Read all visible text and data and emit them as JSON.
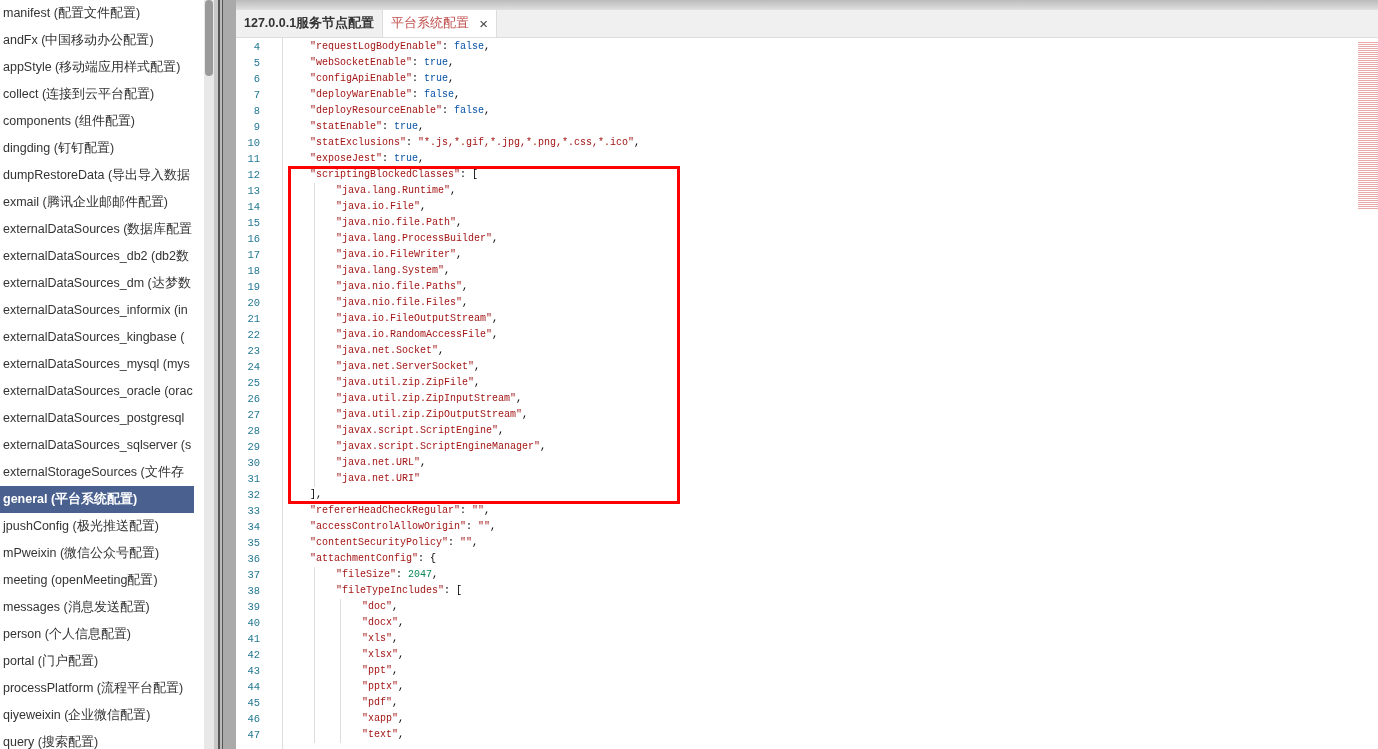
{
  "sidebar": {
    "items": [
      {
        "label": "manifest (配置文件配置)",
        "selected": false
      },
      {
        "label": "andFx (中国移动办公配置)",
        "selected": false
      },
      {
        "label": "appStyle (移动端应用样式配置)",
        "selected": false
      },
      {
        "label": "collect (连接到云平台配置)",
        "selected": false
      },
      {
        "label": "components (组件配置)",
        "selected": false
      },
      {
        "label": "dingding (钉钉配置)",
        "selected": false
      },
      {
        "label": "dumpRestoreData (导出导入数据",
        "selected": false
      },
      {
        "label": "exmail (腾讯企业邮邮件配置)",
        "selected": false
      },
      {
        "label": "externalDataSources (数据库配置",
        "selected": false
      },
      {
        "label": "externalDataSources_db2 (db2数",
        "selected": false
      },
      {
        "label": "externalDataSources_dm (达梦数",
        "selected": false
      },
      {
        "label": "externalDataSources_informix (in",
        "selected": false
      },
      {
        "label": "externalDataSources_kingbase (",
        "selected": false
      },
      {
        "label": "externalDataSources_mysql (mys",
        "selected": false
      },
      {
        "label": "externalDataSources_oracle (orac",
        "selected": false
      },
      {
        "label": "externalDataSources_postgresql",
        "selected": false
      },
      {
        "label": "externalDataSources_sqlserver (s",
        "selected": false
      },
      {
        "label": "externalStorageSources (文件存",
        "selected": false
      },
      {
        "label": "general (平台系统配置)",
        "selected": true
      },
      {
        "label": "jpushConfig (极光推送配置)",
        "selected": false
      },
      {
        "label": "mPweixin (微信公众号配置)",
        "selected": false
      },
      {
        "label": "meeting (openMeeting配置)",
        "selected": false
      },
      {
        "label": "messages (消息发送配置)",
        "selected": false
      },
      {
        "label": "person (个人信息配置)",
        "selected": false
      },
      {
        "label": "portal (门户配置)",
        "selected": false
      },
      {
        "label": "processPlatform (流程平台配置)",
        "selected": false
      },
      {
        "label": "qiyeweixin (企业微信配置)",
        "selected": false
      },
      {
        "label": "query (搜索配置)",
        "selected": false
      }
    ]
  },
  "tabs": [
    {
      "label": "127.0.0.1服务节点配置",
      "selected": false
    },
    {
      "label": "平台系统配置",
      "selected": true,
      "close_glyph": "×"
    }
  ],
  "code": {
    "lines": [
      {
        "no": "4",
        "tokens": [
          {
            "kind": "key",
            "text": "\"requestLogBodyEnable\""
          },
          {
            "kind": "punct",
            "text": ": "
          },
          {
            "kind": "bool",
            "text": "false"
          },
          {
            "kind": "punct",
            "text": ","
          }
        ]
      },
      {
        "no": "5",
        "tokens": [
          {
            "kind": "key",
            "text": "\"webSocketEnable\""
          },
          {
            "kind": "punct",
            "text": ": "
          },
          {
            "kind": "bool",
            "text": "true"
          },
          {
            "kind": "punct",
            "text": ","
          }
        ]
      },
      {
        "no": "6",
        "tokens": [
          {
            "kind": "key",
            "text": "\"configApiEnable\""
          },
          {
            "kind": "punct",
            "text": ": "
          },
          {
            "kind": "bool",
            "text": "true"
          },
          {
            "kind": "punct",
            "text": ","
          }
        ]
      },
      {
        "no": "7",
        "tokens": [
          {
            "kind": "key",
            "text": "\"deployWarEnable\""
          },
          {
            "kind": "punct",
            "text": ": "
          },
          {
            "kind": "bool",
            "text": "false"
          },
          {
            "kind": "punct",
            "text": ","
          }
        ]
      },
      {
        "no": "8",
        "tokens": [
          {
            "kind": "key",
            "text": "\"deployResourceEnable\""
          },
          {
            "kind": "punct",
            "text": ": "
          },
          {
            "kind": "bool",
            "text": "false"
          },
          {
            "kind": "punct",
            "text": ","
          }
        ]
      },
      {
        "no": "9",
        "tokens": [
          {
            "kind": "key",
            "text": "\"statEnable\""
          },
          {
            "kind": "punct",
            "text": ": "
          },
          {
            "kind": "bool",
            "text": "true"
          },
          {
            "kind": "punct",
            "text": ","
          }
        ]
      },
      {
        "no": "10",
        "tokens": [
          {
            "kind": "key",
            "text": "\"statExclusions\""
          },
          {
            "kind": "punct",
            "text": ": "
          },
          {
            "kind": "string",
            "text": "\"*.js,*.gif,*.jpg,*.png,*.css,*.ico\""
          },
          {
            "kind": "punct",
            "text": ","
          }
        ]
      },
      {
        "no": "11",
        "tokens": [
          {
            "kind": "key",
            "text": "\"exposeJest\""
          },
          {
            "kind": "punct",
            "text": ": "
          },
          {
            "kind": "bool",
            "text": "true"
          },
          {
            "kind": "punct",
            "text": ","
          }
        ]
      },
      {
        "no": "12",
        "highlighted": true,
        "tokens": [
          {
            "kind": "key",
            "text": "\"scriptingBlockedClasses\""
          },
          {
            "kind": "punct",
            "text": ": ["
          }
        ],
        "children": [
          {
            "no": "13",
            "tokens": [
              {
                "kind": "string",
                "text": "\"java.lang.Runtime\""
              },
              {
                "kind": "punct",
                "text": ","
              }
            ]
          },
          {
            "no": "14",
            "tokens": [
              {
                "kind": "string",
                "text": "\"java.io.File\""
              },
              {
                "kind": "punct",
                "text": ","
              }
            ]
          },
          {
            "no": "15",
            "tokens": [
              {
                "kind": "string",
                "text": "\"java.nio.file.Path\""
              },
              {
                "kind": "punct",
                "text": ","
              }
            ]
          },
          {
            "no": "16",
            "tokens": [
              {
                "kind": "string",
                "text": "\"java.lang.ProcessBuilder\""
              },
              {
                "kind": "punct",
                "text": ","
              }
            ]
          },
          {
            "no": "17",
            "tokens": [
              {
                "kind": "string",
                "text": "\"java.io.FileWriter\""
              },
              {
                "kind": "punct",
                "text": ","
              }
            ]
          },
          {
            "no": "18",
            "tokens": [
              {
                "kind": "string",
                "text": "\"java.lang.System\""
              },
              {
                "kind": "punct",
                "text": ","
              }
            ]
          },
          {
            "no": "19",
            "tokens": [
              {
                "kind": "string",
                "text": "\"java.nio.file.Paths\""
              },
              {
                "kind": "punct",
                "text": ","
              }
            ]
          },
          {
            "no": "20",
            "tokens": [
              {
                "kind": "string",
                "text": "\"java.nio.file.Files\""
              },
              {
                "kind": "punct",
                "text": ","
              }
            ]
          },
          {
            "no": "21",
            "tokens": [
              {
                "kind": "string",
                "text": "\"java.io.FileOutputStream\""
              },
              {
                "kind": "punct",
                "text": ","
              }
            ]
          },
          {
            "no": "22",
            "tokens": [
              {
                "kind": "string",
                "text": "\"java.io.RandomAccessFile\""
              },
              {
                "kind": "punct",
                "text": ","
              }
            ]
          },
          {
            "no": "23",
            "tokens": [
              {
                "kind": "string",
                "text": "\"java.net.Socket\""
              },
              {
                "kind": "punct",
                "text": ","
              }
            ]
          },
          {
            "no": "24",
            "tokens": [
              {
                "kind": "string",
                "text": "\"java.net.ServerSocket\""
              },
              {
                "kind": "punct",
                "text": ","
              }
            ]
          },
          {
            "no": "25",
            "tokens": [
              {
                "kind": "string",
                "text": "\"java.util.zip.ZipFile\""
              },
              {
                "kind": "punct",
                "text": ","
              }
            ]
          },
          {
            "no": "26",
            "tokens": [
              {
                "kind": "string",
                "text": "\"java.util.zip.ZipInputStream\""
              },
              {
                "kind": "punct",
                "text": ","
              }
            ]
          },
          {
            "no": "27",
            "tokens": [
              {
                "kind": "string",
                "text": "\"java.util.zip.ZipOutputStream\""
              },
              {
                "kind": "punct",
                "text": ","
              }
            ]
          },
          {
            "no": "28",
            "tokens": [
              {
                "kind": "string",
                "text": "\"javax.script.ScriptEngine\""
              },
              {
                "kind": "punct",
                "text": ","
              }
            ]
          },
          {
            "no": "29",
            "tokens": [
              {
                "kind": "string",
                "text": "\"javax.script.ScriptEngineManager\""
              },
              {
                "kind": "punct",
                "text": ","
              }
            ]
          },
          {
            "no": "30",
            "tokens": [
              {
                "kind": "string",
                "text": "\"java.net.URL\""
              },
              {
                "kind": "punct",
                "text": ","
              }
            ]
          },
          {
            "no": "31",
            "tokens": [
              {
                "kind": "string",
                "text": "\"java.net.URI\""
              }
            ]
          }
        ],
        "close": {
          "no": "32",
          "tokens": [
            {
              "kind": "punct",
              "text": "],"
            }
          ]
        }
      },
      {
        "no": "33",
        "tokens": [
          {
            "kind": "key",
            "text": "\"refererHeadCheckRegular\""
          },
          {
            "kind": "punct",
            "text": ": "
          },
          {
            "kind": "string",
            "text": "\"\""
          },
          {
            "kind": "punct",
            "text": ","
          }
        ]
      },
      {
        "no": "34",
        "tokens": [
          {
            "kind": "key",
            "text": "\"accessControlAllowOrigin\""
          },
          {
            "kind": "punct",
            "text": ": "
          },
          {
            "kind": "string",
            "text": "\"\""
          },
          {
            "kind": "punct",
            "text": ","
          }
        ]
      },
      {
        "no": "35",
        "tokens": [
          {
            "kind": "key",
            "text": "\"contentSecurityPolicy\""
          },
          {
            "kind": "punct",
            "text": ": "
          },
          {
            "kind": "string",
            "text": "\"\""
          },
          {
            "kind": "punct",
            "text": ","
          }
        ]
      },
      {
        "no": "36",
        "tokens": [
          {
            "kind": "key",
            "text": "\"attachmentConfig\""
          },
          {
            "kind": "punct",
            "text": ": {"
          }
        ],
        "children": [
          {
            "no": "37",
            "tokens": [
              {
                "kind": "key",
                "text": "\"fileSize\""
              },
              {
                "kind": "punct",
                "text": ": "
              },
              {
                "kind": "number",
                "text": "2047"
              },
              {
                "kind": "punct",
                "text": ","
              }
            ]
          },
          {
            "no": "38",
            "tokens": [
              {
                "kind": "key",
                "text": "\"fileTypeIncludes\""
              },
              {
                "kind": "punct",
                "text": ": ["
              }
            ],
            "children": [
              {
                "no": "39",
                "tokens": [
                  {
                    "kind": "string",
                    "text": "\"doc\""
                  },
                  {
                    "kind": "punct",
                    "text": ","
                  }
                ]
              },
              {
                "no": "40",
                "tokens": [
                  {
                    "kind": "string",
                    "text": "\"docx\""
                  },
                  {
                    "kind": "punct",
                    "text": ","
                  }
                ]
              },
              {
                "no": "41",
                "tokens": [
                  {
                    "kind": "string",
                    "text": "\"xls\""
                  },
                  {
                    "kind": "punct",
                    "text": ","
                  }
                ]
              },
              {
                "no": "42",
                "tokens": [
                  {
                    "kind": "string",
                    "text": "\"xlsx\""
                  },
                  {
                    "kind": "punct",
                    "text": ","
                  }
                ]
              },
              {
                "no": "43",
                "tokens": [
                  {
                    "kind": "string",
                    "text": "\"ppt\""
                  },
                  {
                    "kind": "punct",
                    "text": ","
                  }
                ]
              },
              {
                "no": "44",
                "tokens": [
                  {
                    "kind": "string",
                    "text": "\"pptx\""
                  },
                  {
                    "kind": "punct",
                    "text": ","
                  }
                ]
              },
              {
                "no": "45",
                "tokens": [
                  {
                    "kind": "string",
                    "text": "\"pdf\""
                  },
                  {
                    "kind": "punct",
                    "text": ","
                  }
                ]
              },
              {
                "no": "46",
                "tokens": [
                  {
                    "kind": "string",
                    "text": "\"xapp\""
                  },
                  {
                    "kind": "punct",
                    "text": ","
                  }
                ]
              },
              {
                "no": "47",
                "tokens": [
                  {
                    "kind": "string",
                    "text": "\"text\""
                  },
                  {
                    "kind": "punct",
                    "text": ","
                  }
                ]
              }
            ]
          }
        ]
      }
    ]
  }
}
